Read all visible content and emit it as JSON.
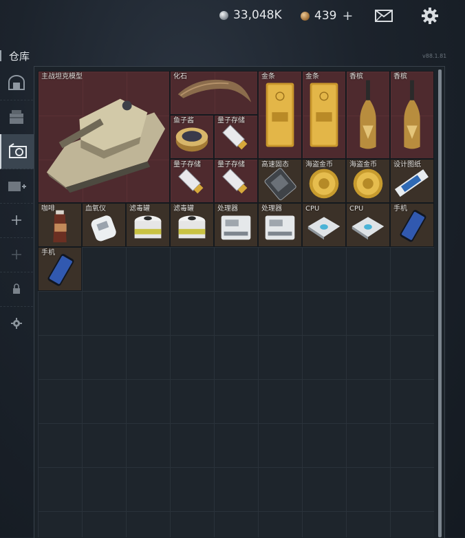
{
  "currency": {
    "silver_value": "33,048K",
    "bronze_value": "439",
    "add_label": "+",
    "colors": {
      "silver": "#c9ced3",
      "bronze": "#b8874e"
    }
  },
  "header": {
    "icons": [
      "mail-icon",
      "gear-icon"
    ],
    "title": "仓库",
    "version": "v88.1.81"
  },
  "sidebar": {
    "items": [
      {
        "icon": "bunker-icon"
      },
      {
        "icon": "crate-icon"
      },
      {
        "icon": "warehouse-icon",
        "active": true
      },
      {
        "icon": "add-storage-icon"
      },
      {
        "icon": "plus-icon"
      },
      {
        "icon": "plus-dim-icon"
      },
      {
        "icon": "lock-icon"
      },
      {
        "icon": "settings-icon"
      }
    ]
  },
  "items": [
    {
      "label": "主战坦克模型",
      "rarity": "red",
      "icon": "tank-model-icon"
    },
    {
      "label": "化石",
      "rarity": "red",
      "icon": "fossil-claw-icon"
    },
    {
      "label": "金条",
      "rarity": "red",
      "icon": "gold-bar-icon"
    },
    {
      "label": "金条",
      "rarity": "red",
      "icon": "gold-bar-icon"
    },
    {
      "label": "香槟",
      "rarity": "red",
      "icon": "champagne-icon"
    },
    {
      "label": "香槟",
      "rarity": "red",
      "icon": "champagne-icon"
    },
    {
      "label": "鱼子酱",
      "rarity": "red",
      "icon": "caviar-icon"
    },
    {
      "label": "量子存储",
      "rarity": "red",
      "icon": "usb-drive-icon"
    },
    {
      "label": "量子存储",
      "rarity": "red",
      "icon": "usb-drive-icon"
    },
    {
      "label": "量子存储",
      "rarity": "red",
      "icon": "usb-drive-icon"
    },
    {
      "label": "高速固态",
      "rarity": "brown",
      "icon": "ssd-icon"
    },
    {
      "label": "海盗金币",
      "rarity": "brown",
      "icon": "gold-coin-icon"
    },
    {
      "label": "海盗金币",
      "rarity": "brown",
      "icon": "gold-coin-icon"
    },
    {
      "label": "设计图纸",
      "rarity": "brown",
      "icon": "blueprint-icon"
    },
    {
      "label": "咖啡",
      "rarity": "brown",
      "icon": "coffee-bottle-icon"
    },
    {
      "label": "血氧仪",
      "rarity": "brown",
      "icon": "oximeter-icon"
    },
    {
      "label": "滤毒罐",
      "rarity": "brown",
      "icon": "filter-canister-icon"
    },
    {
      "label": "滤毒罐",
      "rarity": "brown",
      "icon": "filter-canister-icon"
    },
    {
      "label": "处理器",
      "rarity": "brown",
      "icon": "processor-unit-icon"
    },
    {
      "label": "处理器",
      "rarity": "brown",
      "icon": "processor-unit-icon"
    },
    {
      "label": "CPU",
      "rarity": "brown",
      "icon": "cpu-chip-icon"
    },
    {
      "label": "CPU",
      "rarity": "brown",
      "icon": "cpu-chip-icon"
    },
    {
      "label": "手机",
      "rarity": "brown",
      "icon": "smartphone-icon"
    },
    {
      "label": "手机",
      "rarity": "brown",
      "icon": "smartphone-icon"
    }
  ]
}
